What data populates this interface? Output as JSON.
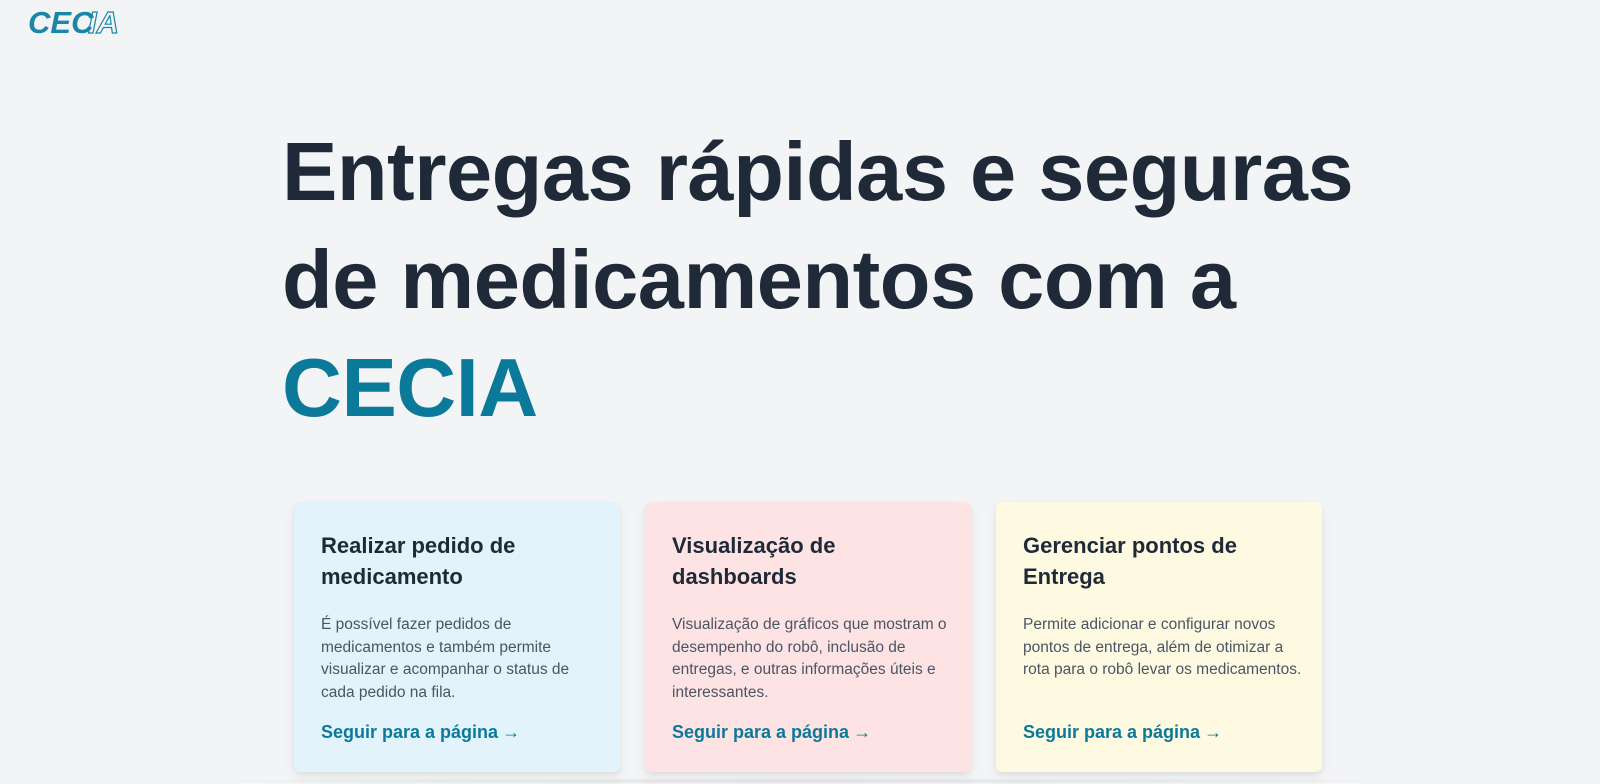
{
  "logo": {
    "part1": "CEC",
    "part2": "IA",
    "primary_color": "#1a86a8"
  },
  "hero": {
    "line1": "Entregas rápidas e seguras",
    "line2": "de medicamentos com a",
    "brand": "CECIA"
  },
  "cards": [
    {
      "title": "Realizar pedido de medicamento",
      "description": "É possível fazer pedidos de medicamentos e também permite visualizar e acompanhar o status de cada pedido na fila.",
      "link": "Seguir para a página",
      "arrow": "→",
      "background": "#e2f3fc"
    },
    {
      "title": "Visualização de dashboards",
      "description": "Visualização de gráficos que mostram o desempenho do robô, inclusão de entregas, e outras informações úteis e interessantes.",
      "link": "Seguir para a página",
      "arrow": "→",
      "background": "#fde3e3"
    },
    {
      "title": "Gerenciar pontos de Entrega",
      "description": "Permite adicionar e configurar novos pontos de entrega, além de otimizar a rota para o robô levar os medicamentos.",
      "link": "Seguir para a página",
      "arrow": "→",
      "background": "#fef9e1"
    }
  ],
  "colors": {
    "accent": "#0b7a9a",
    "heading": "#1f2937",
    "body_text": "#4b5563",
    "page_background": "#f3f4f6"
  }
}
